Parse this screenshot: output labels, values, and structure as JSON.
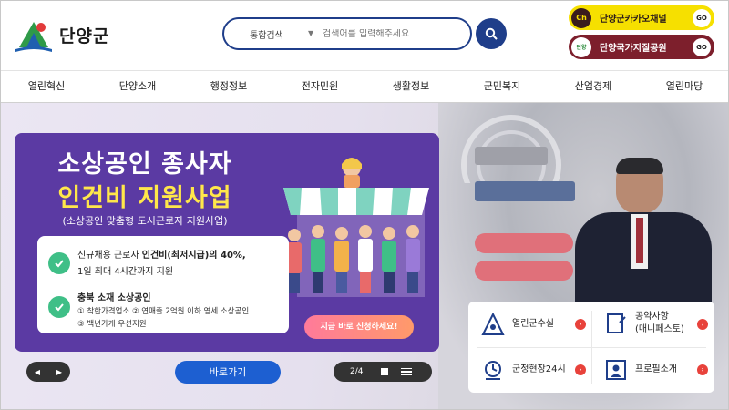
{
  "header": {
    "logo_text": "단양군",
    "search": {
      "category": "통합검색",
      "placeholder": "검색어를 입력해주세요"
    },
    "quick_links": [
      {
        "badge": "Ch",
        "label": "단양군카카오채널",
        "go": "GO"
      },
      {
        "badge": "단양",
        "label": "단양국가지질공원",
        "go": "GO"
      }
    ]
  },
  "nav": {
    "items": [
      "열린혁신",
      "단양소개",
      "행정정보",
      "전자민원",
      "생활정보",
      "군민복지",
      "산업경제",
      "열린마당"
    ]
  },
  "banner": {
    "title1": "소상공인 종사자",
    "title2": "인건비 지원사업",
    "subtitle": "(소상공인 맞춤형 도시근로자 지원사업)",
    "item1_line1_a": "신규채용 근로자 ",
    "item1_line1_b": "인건비(최저시급)의 40%,",
    "item1_line2": "1일 최대 4시간까지 지원",
    "item2_title": "충북 소재 소상공인",
    "item2_sub1": "① 착한가격업소  ② 연매출 2억원 이하 영세 소상공인",
    "item2_sub2": "③ 백년가게 우선지원",
    "cta": "지금 바로 신청하세요!"
  },
  "controls": {
    "go_label": "바로가기",
    "page": "2/4"
  },
  "panel": {
    "items": [
      {
        "label": "열린군수실"
      },
      {
        "label": "공약사항\n(매니페스토)"
      },
      {
        "label": "군정현장24시"
      },
      {
        "label": "프로필소개"
      }
    ]
  },
  "colors": {
    "brand_navy": "#1f3e8a",
    "banner_purple": "#5b3aa3",
    "kakao_yellow": "#f6e000",
    "geopark_maroon": "#7d1f2c",
    "go_button_blue": "#1d5fd1",
    "arrow_red": "#e8423b"
  }
}
